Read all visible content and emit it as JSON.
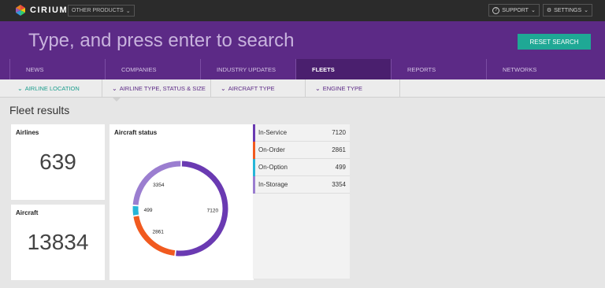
{
  "topbar": {
    "brand": "CIRIUM",
    "other_products": "OTHER PRODUCTS",
    "support": "SUPPORT",
    "settings": "SETTINGS"
  },
  "search": {
    "placeholder": "Type, and press enter to search",
    "reset_label": "RESET SEARCH"
  },
  "nav": {
    "items": [
      {
        "label": "NEWS"
      },
      {
        "label": "COMPANIES"
      },
      {
        "label": "INDUSTRY UPDATES"
      },
      {
        "label": "FLEETS"
      },
      {
        "label": "REPORTS"
      },
      {
        "label": "NETWORKS"
      }
    ],
    "active": "FLEETS"
  },
  "filters": {
    "items": [
      {
        "label": "AIRLINE LOCATION"
      },
      {
        "label": "AIRLINE TYPE, STATUS & SIZE"
      },
      {
        "label": "AIRCRAFT TYPE"
      },
      {
        "label": "ENGINE TYPE"
      }
    ]
  },
  "results": {
    "title": "Fleet results",
    "airlines_label": "Airlines",
    "airlines_value": "639",
    "aircraft_label": "Aircraft",
    "aircraft_value": "13834",
    "status_title": "Aircraft status"
  },
  "chart_data": {
    "type": "pie",
    "title": "Aircraft status",
    "slices": [
      {
        "label": "In-Service",
        "value": 7120,
        "color": "#6a3ab2"
      },
      {
        "label": "On-Order",
        "value": 2861,
        "color": "#f15a1f"
      },
      {
        "label": "On-Option",
        "value": 499,
        "color": "#27b5d8"
      },
      {
        "label": "In-Storage",
        "value": 3354,
        "color": "#9b7ed0"
      }
    ]
  },
  "legend": {
    "rows": [
      {
        "label": "In-Service",
        "value": "7120",
        "color": "#6a3ab2"
      },
      {
        "label": "On-Order",
        "value": "2861",
        "color": "#f15a1f"
      },
      {
        "label": "On-Option",
        "value": "499",
        "color": "#27b5d8"
      },
      {
        "label": "In-Storage",
        "value": "3354",
        "color": "#9b7ed0"
      }
    ]
  }
}
